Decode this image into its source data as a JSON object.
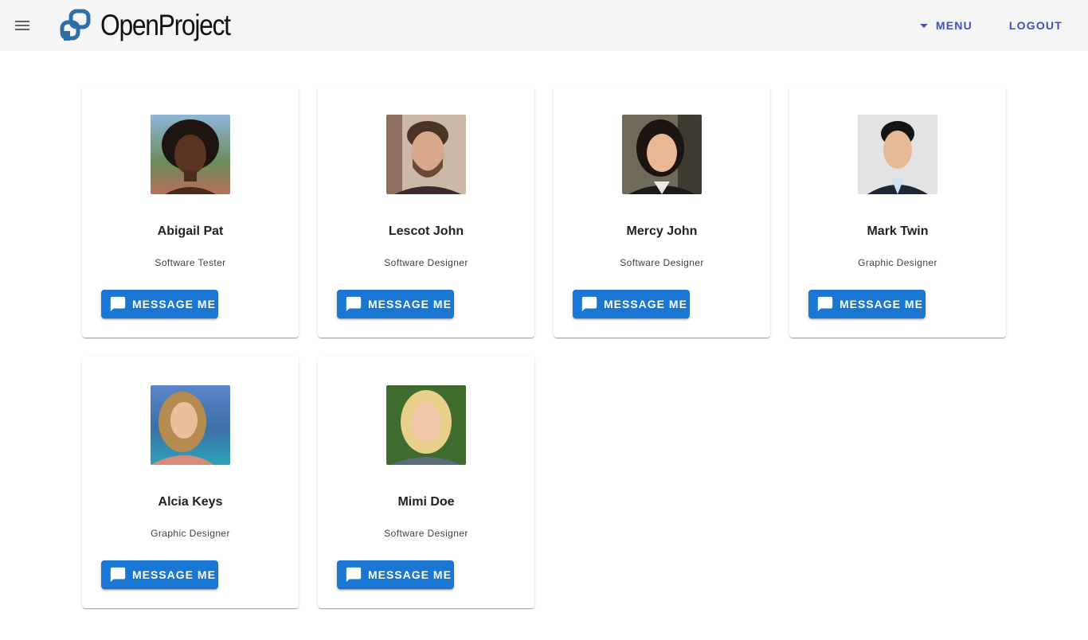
{
  "header": {
    "brand": "OpenProject",
    "menu_label": "MENU",
    "logout_label": "LOGOUT",
    "background": "#f5f5f5",
    "link_color": "#3f51b5"
  },
  "cards": [
    {
      "name": "Abigail Pat",
      "role": "Software Tester",
      "button_label": "MESSAGE ME"
    },
    {
      "name": "Lescot John",
      "role": "Software Designer",
      "button_label": "MESSAGE ME"
    },
    {
      "name": "Mercy John",
      "role": "Software Designer",
      "button_label": "MESSAGE ME"
    },
    {
      "name": "Mark Twin",
      "role": "Graphic Designer",
      "button_label": "MESSAGE ME"
    },
    {
      "name": "Alcia Keys",
      "role": "Graphic Designer",
      "button_label": "MESSAGE ME"
    },
    {
      "name": "Mimi Doe",
      "role": "Software Designer",
      "button_label": "MESSAGE ME"
    }
  ],
  "colors": {
    "button": "#1976d2",
    "button_text": "#ffffff"
  },
  "icons": {
    "nav": "hamburger-menu-icon",
    "menu_caret": "caret-down-icon",
    "message": "message-icon"
  }
}
